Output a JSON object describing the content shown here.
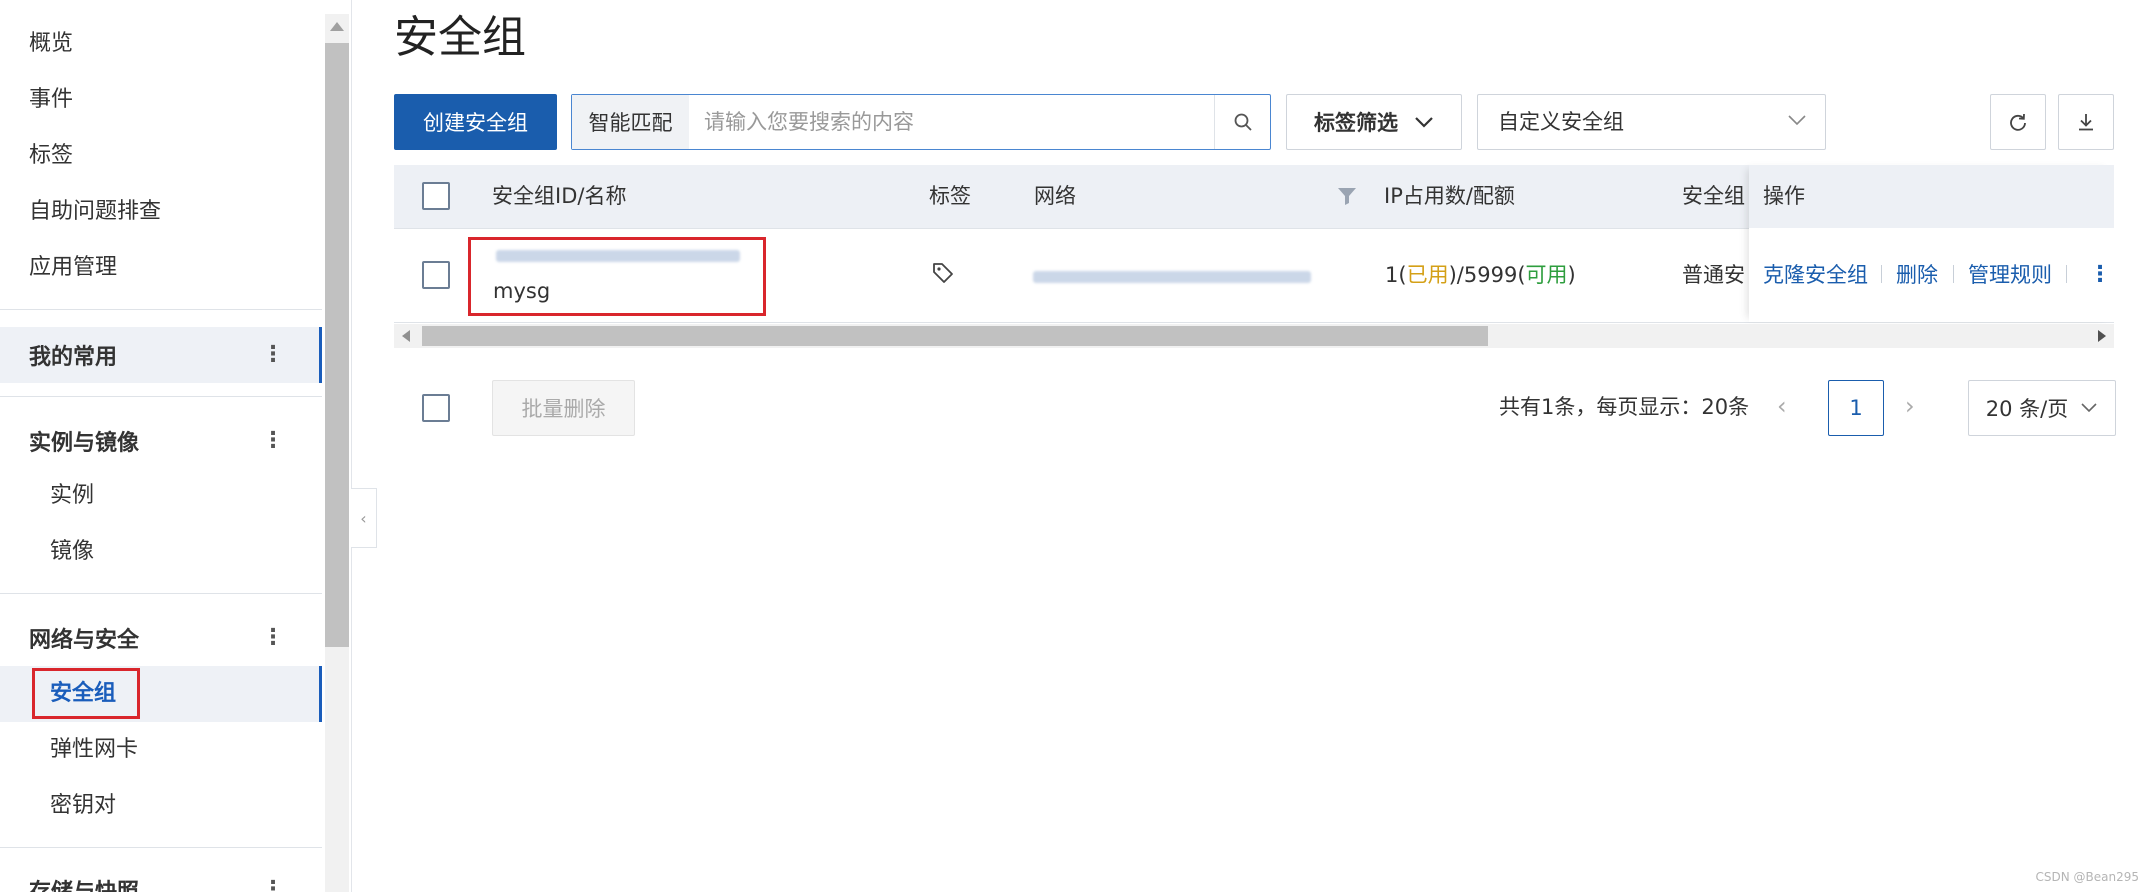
{
  "sidebar": {
    "top_items": [
      "概览",
      "事件",
      "标签",
      "自助问题排查",
      "应用管理"
    ],
    "favorites": {
      "label": "我的常用"
    },
    "groups": [
      {
        "label": "实例与镜像",
        "items": [
          "实例",
          "镜像"
        ]
      },
      {
        "label": "网络与安全",
        "items": [
          "安全组",
          "弹性网卡",
          "密钥对"
        ]
      },
      {
        "label": "存储与快照"
      }
    ]
  },
  "header": {
    "title": "安全组"
  },
  "toolbar": {
    "create_label": "创建安全组",
    "search_mode": "智能匹配",
    "search_placeholder": "请输入您要搜索的内容",
    "tag_filter_label": "标签筛选",
    "custom_select_label": "自定义安全组"
  },
  "table": {
    "columns": [
      "安全组ID/名称",
      "标签",
      "网络",
      "IP占用数/配额",
      "安全组",
      "操作"
    ],
    "rows": [
      {
        "name": "mysg",
        "ip_used_num": "1",
        "ip_used_label": "已用",
        "ip_quota": "5999",
        "ip_avail_label": "可用",
        "type": "普通安",
        "actions": [
          "克隆安全组",
          "删除",
          "管理规则"
        ]
      }
    ]
  },
  "footer": {
    "batch_delete_label": "批量删除",
    "page_info": "共有1条，每页显示：20条",
    "current_page": "1",
    "page_size_label": "20 条/页"
  },
  "colors": {
    "primary": "#1a5dad",
    "used": "#d4a017",
    "available": "#2e9e3e",
    "highlight": "#d9262c"
  },
  "watermark": "CSDN @Bean295"
}
